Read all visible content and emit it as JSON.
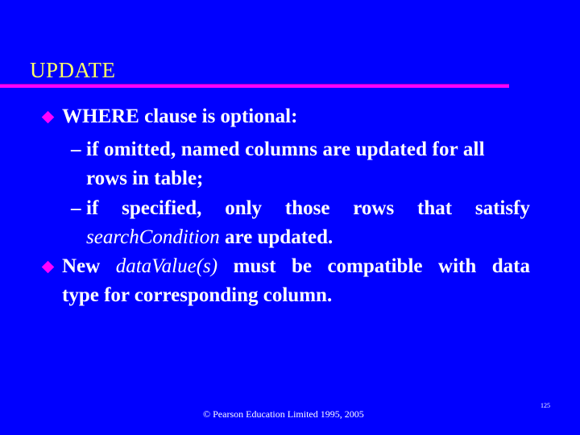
{
  "slide": {
    "title": "UPDATE",
    "colors": {
      "background": "#0000FF",
      "title": "#FFFF66",
      "rule": "#FF00FF",
      "bullet": "#FF00FF",
      "text": "#FFFFFF"
    },
    "bullets": [
      {
        "text": "WHERE clause is optional:",
        "sub_bullets": [
          {
            "dash": "–",
            "line1": "if omitted, named columns are updated for all",
            "line2": "rows in table;"
          },
          {
            "dash": "–",
            "line1_words": [
              "if",
              "specified,",
              "only",
              "those",
              "rows",
              "that",
              "satisfy"
            ],
            "line2_italic": "searchCondition",
            "line2_rest": " are updated."
          }
        ]
      },
      {
        "line1_words": [
          "New",
          "dataValue(s)",
          "must",
          "be",
          "compatible",
          "with",
          "data"
        ],
        "line1_italic_index": 1,
        "line2": "type for corresponding column."
      }
    ],
    "footer": "© Pearson Education Limited 1995, 2005",
    "page_number": "125"
  }
}
